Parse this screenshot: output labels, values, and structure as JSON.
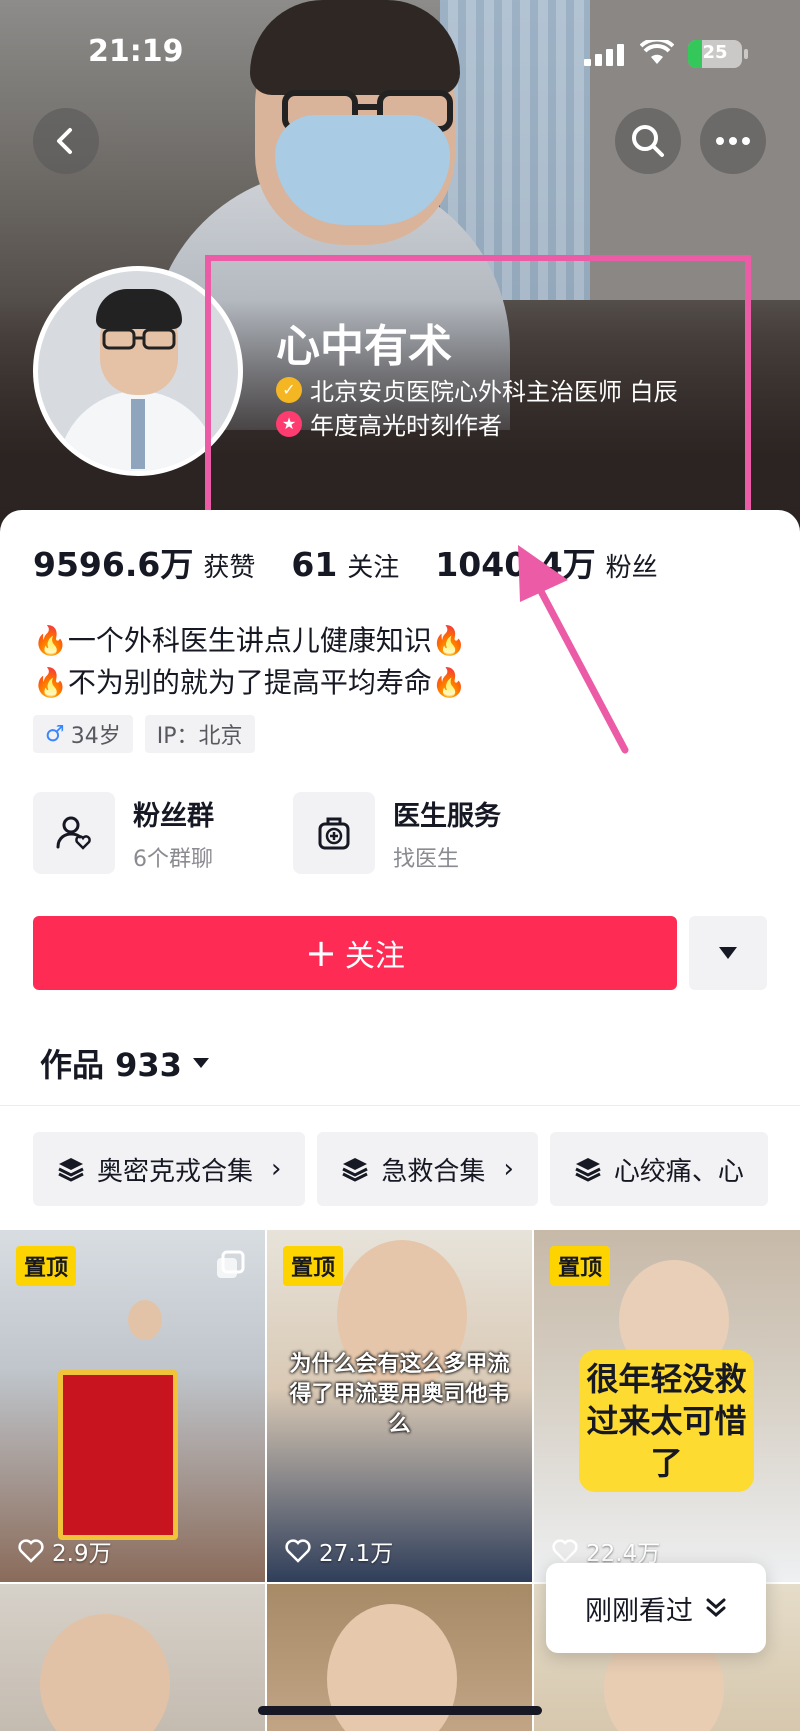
{
  "status_bar": {
    "time": "21:19",
    "battery": "25",
    "battery_fraction": 0.25
  },
  "profile": {
    "nickname": "心中有术",
    "certification": "北京安贞医院心外科主治医师 白辰",
    "award": "年度高光时刻作者"
  },
  "stats": [
    {
      "value": "9596.6万",
      "label": "获赞"
    },
    {
      "value": "61",
      "label": "关注"
    },
    {
      "value": "1040.4万",
      "label": "粉丝"
    }
  ],
  "bio": {
    "line1": "一个外科医生讲点儿健康知识",
    "line2": "不为别的就为了提高平均寿命",
    "emoji": "🔥"
  },
  "tags": {
    "gender_symbol": "♂",
    "age": "34岁",
    "ip": "IP：北京"
  },
  "services": [
    {
      "title": "粉丝群",
      "sub": "6个群聊",
      "icon": "fan-group-icon"
    },
    {
      "title": "医生服务",
      "sub": "找医生",
      "icon": "medical-kit-icon"
    }
  ],
  "follow": {
    "plus": "+",
    "label": "关注"
  },
  "works": {
    "label": "作品 933"
  },
  "collections": [
    {
      "label": "奥密克戎合集"
    },
    {
      "label": "急救合集"
    },
    {
      "label": "心绞痛、心"
    }
  ],
  "videos": [
    {
      "pinned": "置顶",
      "likes": "2.9万",
      "caption": ""
    },
    {
      "pinned": "置顶",
      "likes": "27.1万",
      "caption": "为什么会有这么多甲流得了甲流要用奥司他韦么"
    },
    {
      "pinned": "置顶",
      "likes": "22.4万",
      "caption": "很年轻没救过来太可惜了"
    }
  ],
  "recent": {
    "label": "刚刚看过"
  },
  "colors": {
    "accent": "#fe2c55",
    "highlight_box": "#ec5ba6",
    "pin": "#fdd300"
  }
}
